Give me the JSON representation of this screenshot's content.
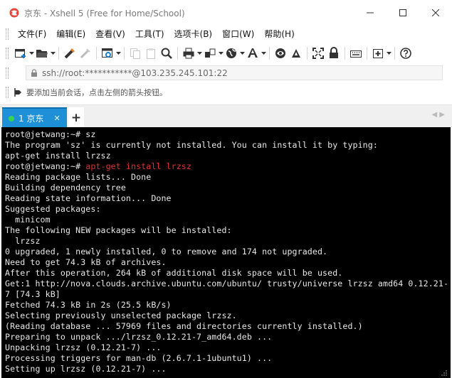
{
  "window": {
    "title": "京东 - Xshell 5 (Free for Home/School)",
    "controls": [
      "minimize",
      "maximize",
      "close"
    ]
  },
  "menu": {
    "items": [
      "文件(F)",
      "编辑(E)",
      "查看(V)",
      "工具(T)",
      "选项卡(B)",
      "窗口(W)",
      "帮助(H)"
    ]
  },
  "toolbar": {
    "icons": [
      "new-session-icon",
      "open-folder-icon",
      "reconnect-icon",
      "disconnect-icon",
      "properties-icon",
      "copy-icon",
      "paste-icon",
      "find-icon",
      "print-icon",
      "transfer-icon",
      "globe-icon",
      "font-icon",
      "xftp-icon",
      "xmanager-icon",
      "fullscreen-icon",
      "lock-icon",
      "keyboard-icon",
      "add-tab-icon",
      "help-icon"
    ]
  },
  "address": {
    "value": "ssh://root:***********@103.235.245.101:22"
  },
  "hint": {
    "text": "要添加当前会话，点击左侧的箭头按钮。"
  },
  "tabs": {
    "active_label": "1 京东",
    "add_symbol": "+",
    "scroll_symbol": "◀ ▶"
  },
  "colors": {
    "tab_active": "#1e90d7",
    "terminal_bg": "#000000",
    "terminal_fg": "#e6e6e6",
    "highlight_cmd": "#e03030",
    "status_dot": "#39d353"
  },
  "terminal": {
    "lines": [
      {
        "prompt": "root@jetwang:~# ",
        "cmd": "sz"
      },
      {
        "text": "The program 'sz' is currently not installed. You can install it by typing:"
      },
      {
        "text": "apt-get install lrzsz"
      },
      {
        "prompt": "root@jetwang:~# ",
        "cmd_red": "apt-get install lrzsz"
      },
      {
        "text": "Reading package lists... Done"
      },
      {
        "text": "Building dependency tree"
      },
      {
        "text": "Reading state information... Done"
      },
      {
        "text": "Suggested packages:"
      },
      {
        "text": "  minicom"
      },
      {
        "text": "The following NEW packages will be installed:"
      },
      {
        "text": "  lrzsz"
      },
      {
        "text": "0 upgraded, 1 newly installed, 0 to remove and 174 not upgraded."
      },
      {
        "text": "Need to get 74.3 kB of archives."
      },
      {
        "text": "After this operation, 264 kB of additional disk space will be used."
      },
      {
        "text": "Get:1 http://nova.clouds.archive.ubuntu.com/ubuntu/ trusty/universe lrzsz amd64 0.12.21-"
      },
      {
        "text": "7 [74.3 kB]"
      },
      {
        "text": "Fetched 74.3 kB in 2s (25.5 kB/s)"
      },
      {
        "text": "Selecting previously unselected package lrzsz."
      },
      {
        "text": "(Reading database ... 57969 files and directories currently installed.)"
      },
      {
        "text": "Preparing to unpack .../lrzsz_0.12.21-7_amd64.deb ..."
      },
      {
        "text": "Unpacking lrzsz (0.12.21-7) ..."
      },
      {
        "text": "Processing triggers for man-db (2.6.7.1-1ubuntu1) ..."
      },
      {
        "text": "Setting up lrzsz (0.12.21-7) ..."
      }
    ]
  }
}
